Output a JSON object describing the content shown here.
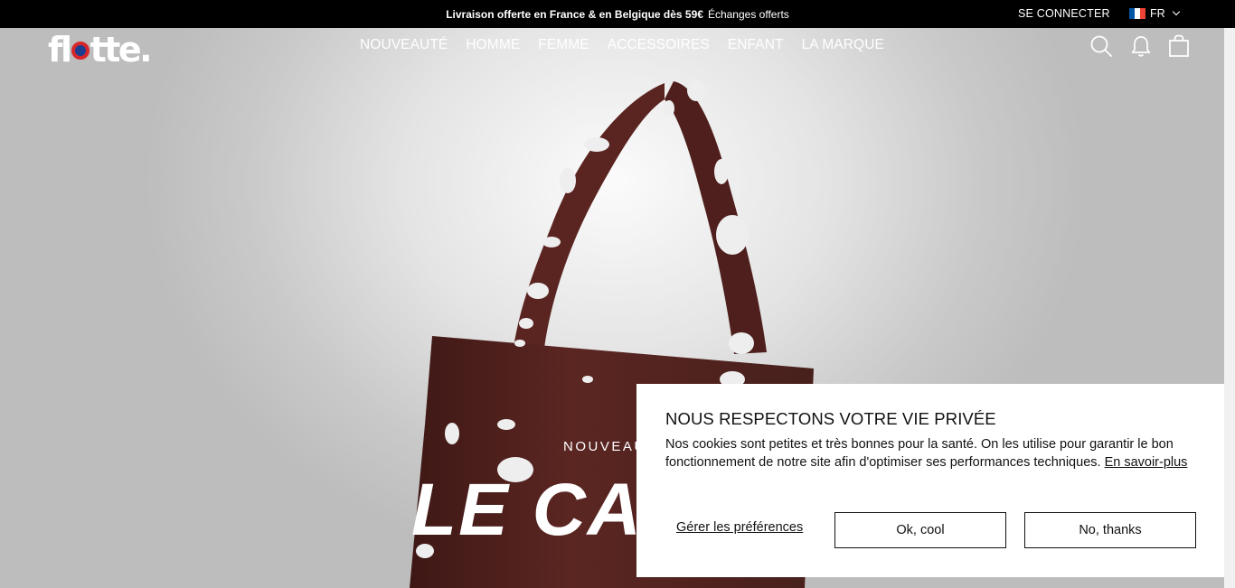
{
  "announcement": {
    "bold": "Livraison offerte en France & en Belgique dès 59€",
    "regular": "Échanges offerts"
  },
  "account": {
    "login_label": "SE CONNECTER"
  },
  "language": {
    "code": "FR",
    "flag_colors": [
      "#0055A4",
      "#FFFFFF",
      "#EF4135"
    ]
  },
  "brand": {
    "logo_start": "fl",
    "logo_end": "tte."
  },
  "nav": {
    "items": [
      "NOUVEAUTÉ",
      "HOMME",
      "FEMME",
      "ACCESSOIRES",
      "ENFANT",
      "LA MARQUE"
    ]
  },
  "header_icons": [
    "search-icon",
    "bell-icon",
    "bag-icon"
  ],
  "hero": {
    "eyebrow": "NOUVEAUTÉ",
    "headline": "LE CABAS"
  },
  "cookie": {
    "title": "NOUS RESPECTONS VOTRE VIE PRIVÉE",
    "text": "Nos cookies sont petites et très bonnes pour la santé. On les utilise pour garantir le bon fonctionnement de notre site afin d'optimiser ses performances techniques.",
    "link": "En savoir-plus",
    "manage": "Gérer les préférences",
    "accept": "Ok, cool",
    "decline": "No, thanks"
  },
  "colors": {
    "bag": "#5a2420",
    "topbar": "#000000"
  }
}
